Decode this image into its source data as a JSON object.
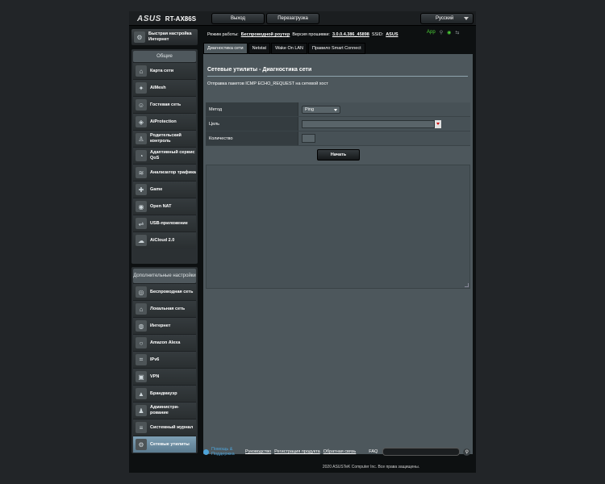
{
  "header": {
    "brand": "ASUS",
    "model": "RT-AX86S",
    "logout_label": "Выход",
    "reboot_label": "Перезагрузка",
    "language": "Русский"
  },
  "status": {
    "mode_label": "Режим работы:",
    "mode_value": "Беспроводной роутер",
    "firmware_label": "Версия прошивки:",
    "firmware_value": "3.0.0.4.386_45898",
    "ssid_label": "SSID:",
    "ssid_value": "ASUS",
    "app_label": "App"
  },
  "sidebar": {
    "quick_setup": "Быстрая настройка Интернет",
    "general_title": "Общие",
    "general_items": [
      {
        "label": "Карта сети",
        "icon": "network-map-icon"
      },
      {
        "label": "AiMesh",
        "icon": "aimesh-icon"
      },
      {
        "label": "Гостевая сеть",
        "icon": "guest-network-icon"
      },
      {
        "label": "AiProtection",
        "icon": "shield-icon"
      },
      {
        "label": "Родительский контроль",
        "icon": "parental-control-icon"
      },
      {
        "label": "Адаптивный сервис QoS",
        "icon": "qos-icon"
      },
      {
        "label": "Анализатор трафика",
        "icon": "traffic-analyzer-icon"
      },
      {
        "label": "Game",
        "icon": "gamepad-icon"
      },
      {
        "label": "Open NAT",
        "icon": "open-nat-icon"
      },
      {
        "label": "USB-приложение",
        "icon": "usb-icon"
      },
      {
        "label": "AiCloud 2.0",
        "icon": "cloud-icon"
      }
    ],
    "advanced_title": "Дополнительные настройки",
    "advanced_items": [
      {
        "label": "Беспроводная сеть",
        "icon": "wireless-icon"
      },
      {
        "label": "Локальная сеть",
        "icon": "lan-icon"
      },
      {
        "label": "Интернет",
        "icon": "globe-icon"
      },
      {
        "label": "Amazon Alexa",
        "icon": "alexa-icon"
      },
      {
        "label": "IPv6",
        "icon": "ipv6-icon"
      },
      {
        "label": "VPN",
        "icon": "vpn-icon"
      },
      {
        "label": "Брандмауэр",
        "icon": "firewall-icon"
      },
      {
        "label": "Администри-рование",
        "icon": "administration-icon"
      },
      {
        "label": "Системный журнал",
        "icon": "system-log-icon"
      },
      {
        "label": "Сетевые утилиты",
        "icon": "network-tools-icon"
      }
    ]
  },
  "tabs": [
    {
      "label": "Диагностика сети",
      "active": true
    },
    {
      "label": "Netstat",
      "active": false
    },
    {
      "label": "Wake On LAN",
      "active": false
    },
    {
      "label": "Правило Smart Connect",
      "active": false
    }
  ],
  "panel": {
    "title": "Сетевые утилиты - Диагностика сети",
    "description": "Отправка пакетов ICMP ECHO_REQUEST на сетевой хост",
    "method_label": "Метод",
    "method_value": "Ping",
    "target_label": "Цель",
    "target_value": "",
    "count_label": "Количество",
    "count_value": "",
    "start_label": "Начать",
    "output_value": ""
  },
  "footer": {
    "help": "Помощь & Поддержка",
    "manual": "Руководство",
    "register": "Регистрация продукта",
    "feedback": "Обратная связь",
    "faq": "FAQ",
    "copyright": "2020 ASUSTeK Computer Inc. Все права защищены."
  }
}
